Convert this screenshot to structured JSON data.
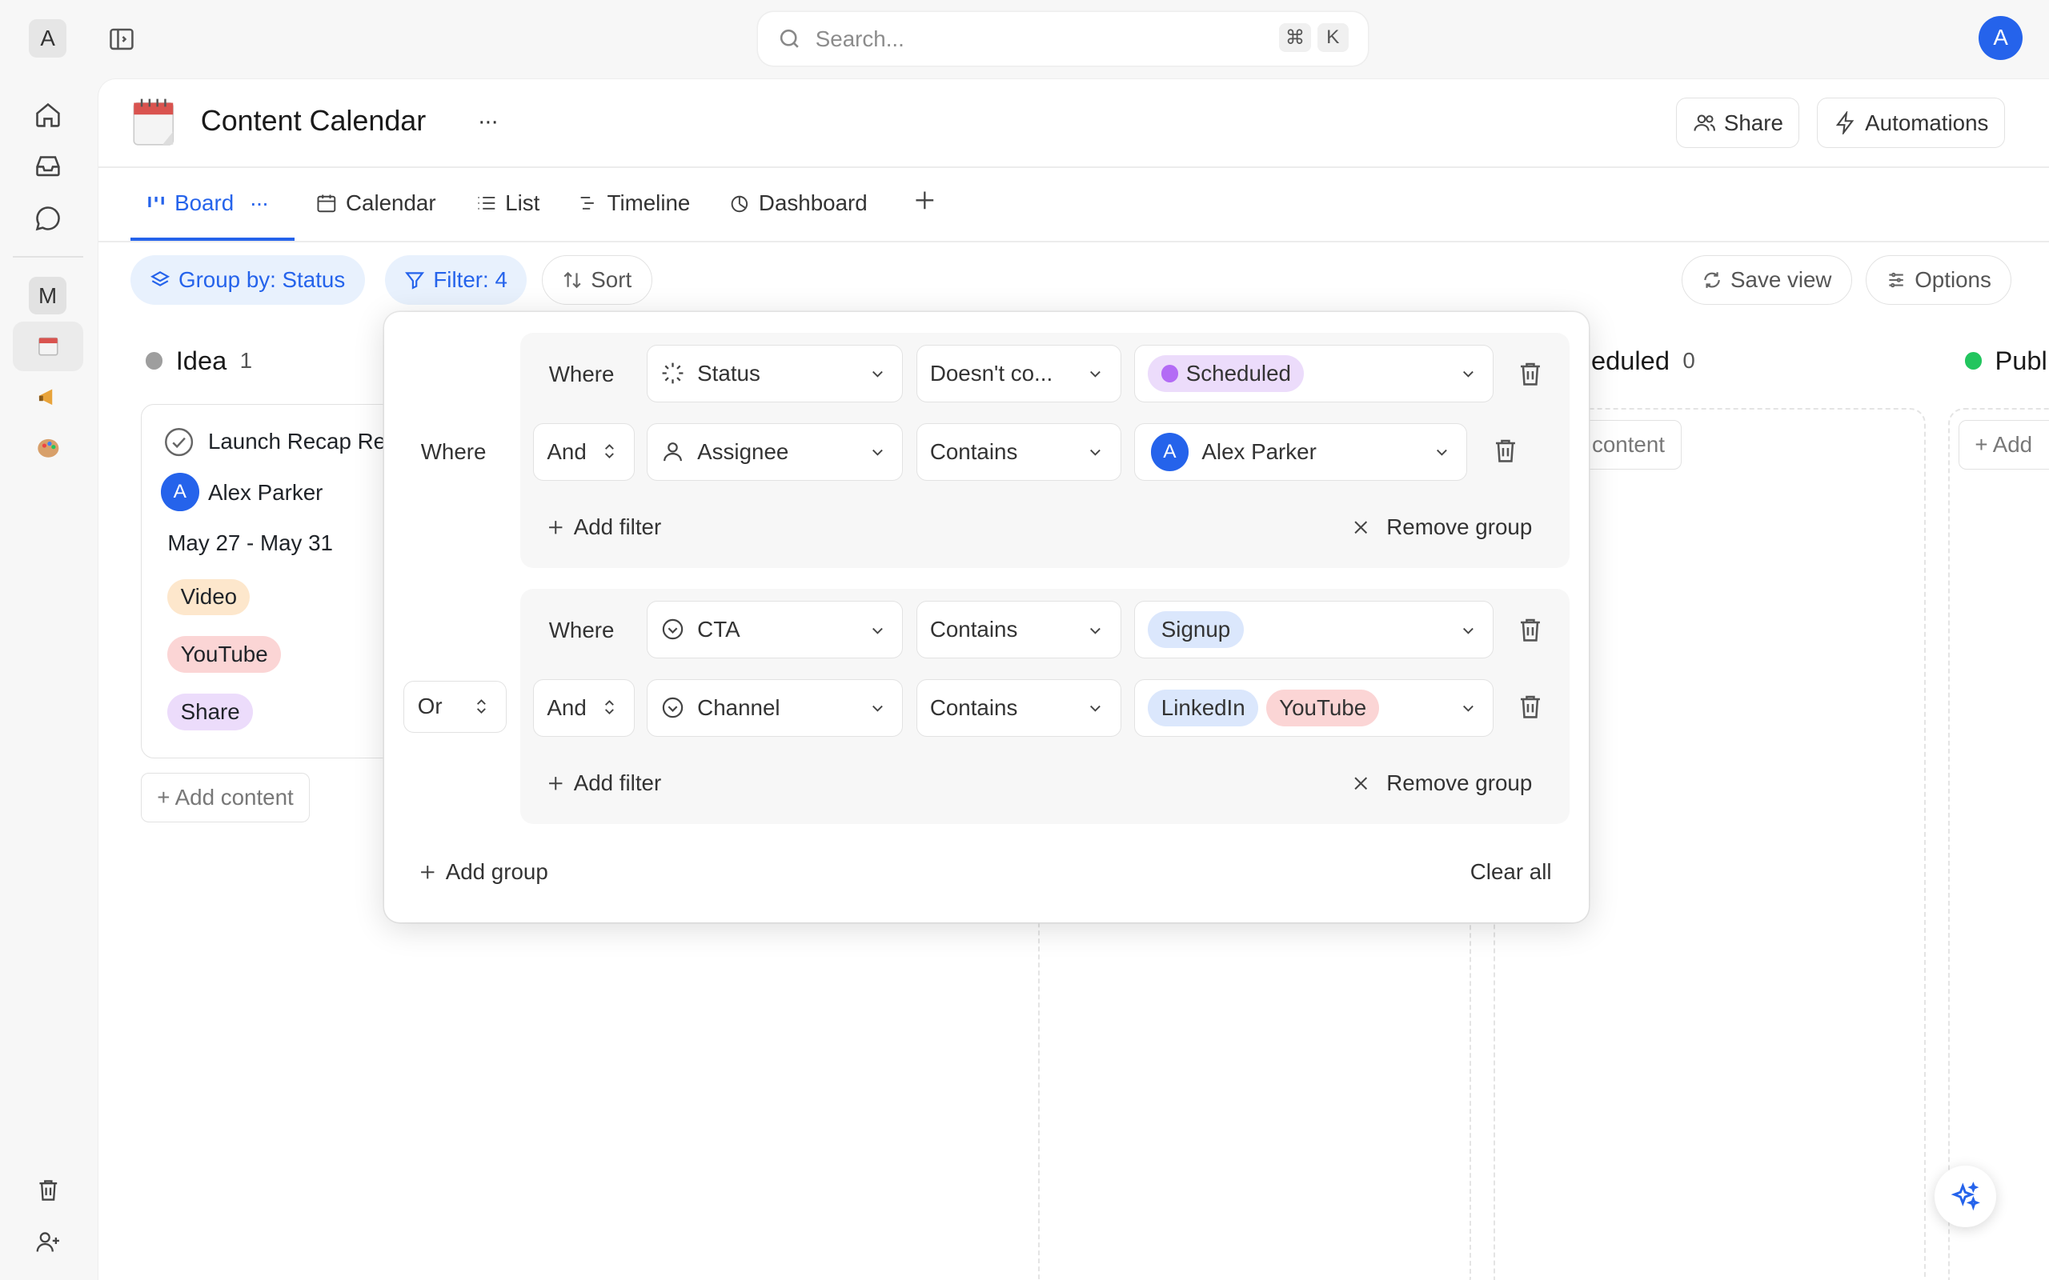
{
  "workspace": {
    "initial": "A",
    "member_initial": "M"
  },
  "search": {
    "placeholder": "Search...",
    "shortcut_cmd": "⌘",
    "shortcut_key": "K"
  },
  "user": {
    "initial": "A"
  },
  "page": {
    "title": "Content Calendar",
    "more": "···"
  },
  "header_buttons": {
    "share": "Share",
    "automations": "Automations"
  },
  "tabs": [
    {
      "label": "Board",
      "active": true
    },
    {
      "label": "Calendar"
    },
    {
      "label": "List"
    },
    {
      "label": "Timeline"
    },
    {
      "label": "Dashboard"
    }
  ],
  "tab_more": "···",
  "toolbar": {
    "group_by": "Group by: Status",
    "filter": "Filter: 4",
    "sort": "Sort",
    "save_view": "Save view",
    "options": "Options"
  },
  "columns": [
    {
      "name": "Idea",
      "count": "1",
      "color": "#9e9e9e"
    },
    {
      "name": "eduled",
      "count": "0"
    },
    {
      "name": "Publ",
      "color": "#22c55e"
    }
  ],
  "card": {
    "title": "Launch Recap Re",
    "assignee_initial": "A",
    "assignee": "Alex Parker",
    "dates": "May 27 - May 31",
    "tags": [
      {
        "label": "Video",
        "bg": "#fde7cc",
        "fg": "#3b2a12"
      },
      {
        "label": "YouTube",
        "bg": "#fbd5d5",
        "fg": "#3b1515"
      },
      {
        "label": "Share",
        "bg": "#ecdcfb",
        "fg": "#2e1548"
      }
    ]
  },
  "add_content": "+ Add content",
  "add_content_partial": "content",
  "add_partial": "+ Add",
  "filter": {
    "where_outer": "Where",
    "or": "Or",
    "groups": [
      {
        "rows": [
          {
            "conj": "Where",
            "field": "Status",
            "op": "Doesn't co...",
            "values": [
              {
                "label": "Scheduled",
                "bg": "#ecdcfb",
                "dot": "#b36bf5"
              }
            ]
          },
          {
            "conj": "And",
            "field": "Assignee",
            "op": "Contains",
            "values": [
              {
                "label": "Alex Parker",
                "avatar": "A"
              }
            ]
          }
        ],
        "add_filter": "Add filter",
        "remove_group": "Remove group"
      },
      {
        "rows": [
          {
            "conj": "Where",
            "field": "CTA",
            "op": "Contains",
            "values": [
              {
                "label": "Signup",
                "bg": "#dbe7fc"
              }
            ]
          },
          {
            "conj": "And",
            "field": "Channel",
            "op": "Contains",
            "values": [
              {
                "label": "LinkedIn",
                "bg": "#dbe7fc"
              },
              {
                "label": "YouTube",
                "bg": "#fbd5d5"
              }
            ]
          }
        ],
        "add_filter": "Add filter",
        "remove_group": "Remove group"
      }
    ],
    "add_group": "Add group",
    "clear_all": "Clear all"
  },
  "colors": {
    "accent": "#2563eb",
    "accent_bg": "#e8f1fd"
  }
}
